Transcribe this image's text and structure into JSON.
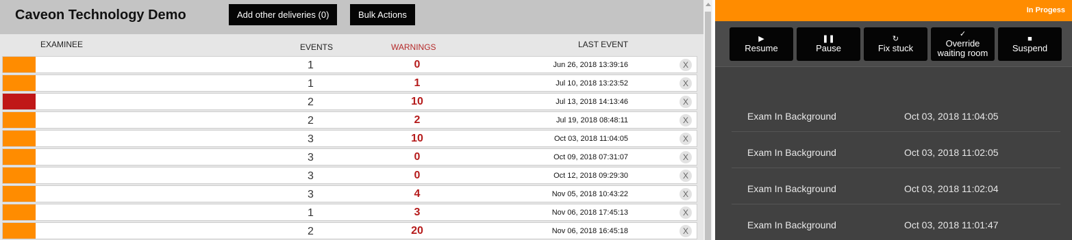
{
  "header": {
    "title": "Caveon Technology Demo",
    "add_deliveries_label": "Add other deliveries (0)",
    "bulk_actions_label": "Bulk Actions"
  },
  "columns": {
    "examinee": "EXAMINEE",
    "events": "EVENTS",
    "warnings": "WARNINGS",
    "last_event": "LAST EVENT"
  },
  "rows": [
    {
      "status": "orange",
      "events": "1",
      "warnings": "0",
      "last_event": "Jun 26, 2018 13:39:16"
    },
    {
      "status": "orange",
      "events": "1",
      "warnings": "1",
      "last_event": "Jul 10, 2018 13:23:52"
    },
    {
      "status": "red",
      "events": "2",
      "warnings": "10",
      "last_event": "Jul 13, 2018 14:13:46"
    },
    {
      "status": "orange",
      "events": "2",
      "warnings": "2",
      "last_event": "Jul 19, 2018 08:48:11"
    },
    {
      "status": "orange",
      "events": "3",
      "warnings": "10",
      "last_event": "Oct 03, 2018 11:04:05"
    },
    {
      "status": "orange",
      "events": "3",
      "warnings": "0",
      "last_event": "Oct 09, 2018 07:31:07"
    },
    {
      "status": "orange",
      "events": "3",
      "warnings": "0",
      "last_event": "Oct 12, 2018 09:29:30"
    },
    {
      "status": "orange",
      "events": "3",
      "warnings": "4",
      "last_event": "Nov 05, 2018 10:43:22"
    },
    {
      "status": "orange",
      "events": "1",
      "warnings": "3",
      "last_event": "Nov 06, 2018 17:45:13"
    },
    {
      "status": "orange",
      "events": "2",
      "warnings": "20",
      "last_event": "Nov 06, 2018 16:45:18"
    }
  ],
  "remove_label": "X",
  "detail": {
    "status": "In Progess",
    "actions": [
      {
        "icon": "▶",
        "label": "Resume"
      },
      {
        "icon": "❚❚",
        "label": "Pause"
      },
      {
        "icon": "↻",
        "label": "Fix stuck"
      },
      {
        "icon": "✓",
        "label": "Override waiting room"
      },
      {
        "icon": "■",
        "label": "Suspend"
      }
    ],
    "log": [
      {
        "event": "Exam In Background",
        "time": "Oct 03, 2018 11:04:05"
      },
      {
        "event": "Exam In Background",
        "time": "Oct 03, 2018 11:02:05"
      },
      {
        "event": "Exam In Background",
        "time": "Oct 03, 2018 11:02:04"
      },
      {
        "event": "Exam In Background",
        "time": "Oct 03, 2018 11:01:47"
      }
    ]
  },
  "colors": {
    "accent_orange": "#ff8c00",
    "alert_red": "#c01818",
    "warning_text": "#b51b1b",
    "panel_dark": "#414141"
  }
}
